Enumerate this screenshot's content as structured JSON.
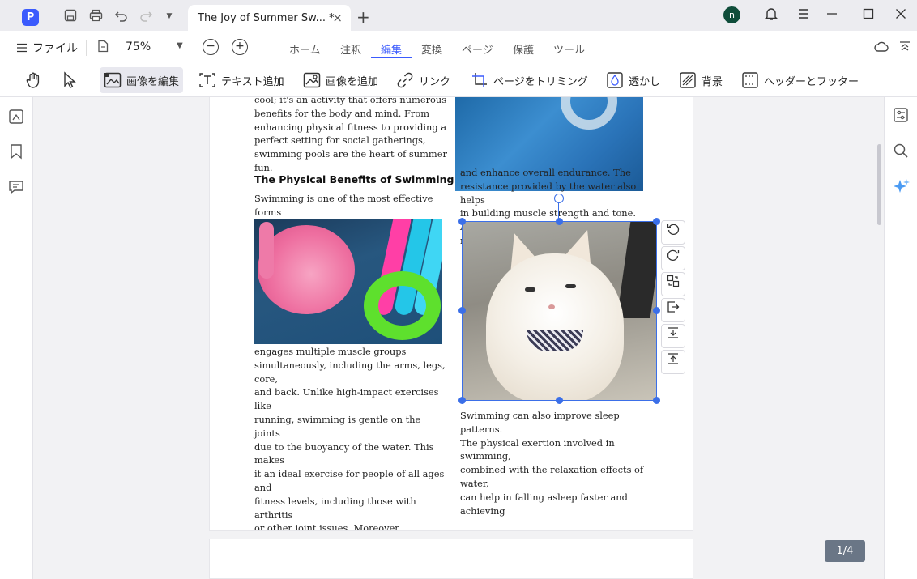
{
  "titlebar": {
    "tab_title": "The Joy of Summer Sw... *",
    "tab_close": "×",
    "new_tab": "+",
    "avatar_letter": "n",
    "app_logo": "P"
  },
  "menubar": {
    "file_label": "ファイル",
    "zoom_value": "75%",
    "tabs": [
      "ホーム",
      "注釈",
      "編集",
      "変換",
      "ページ",
      "保護",
      "ツール"
    ],
    "active_tab": "編集"
  },
  "toolbar": {
    "tools": [
      "画像を編集",
      "テキスト追加",
      "画像を追加",
      "リンク",
      "ページをトリミング",
      "透かし",
      "背景",
      "ヘッダーとフッター"
    ]
  },
  "document": {
    "left_para1": "cool; it's an activity that offers numerous\nbenefits for the body and mind. From\nenhancing physical fitness to providing a\nperfect setting for social gatherings,\nswimming pools are the heart of summer fun.",
    "heading": "The Physical Benefits of Swimming",
    "left_para2": "Swimming is one of the most effective forms\nof exercise. It's a full-body workout that",
    "left_para3": "engages multiple muscle groups\nsimultaneously, including the arms, legs, core,\nand back. Unlike high-impact exercises like\nrunning, swimming is gentle on the joints\ndue to the buoyancy of the water. This makes\nit an ideal exercise for people of all ages and\nfitness levels, including those with arthritis\nor other joint issues. Moreover, swimming\ncan significantly improve cardiovascular",
    "right_para1": "and enhance overall endurance. The\nresistance provided by the water also helps\nin building muscle strength and tone.\nAdditionally, swimming burns a high number",
    "right_para2": "Swimming can also improve sleep patterns.\nThe physical exertion involved in swimming,\ncombined with the relaxation effects of water,\ncan help in falling asleep faster and achieving"
  },
  "page_counter": "1/4",
  "colors": {
    "accent": "#3b5bfd",
    "selection": "#3b6fe8",
    "page_counter_bg": "#6a7686"
  }
}
